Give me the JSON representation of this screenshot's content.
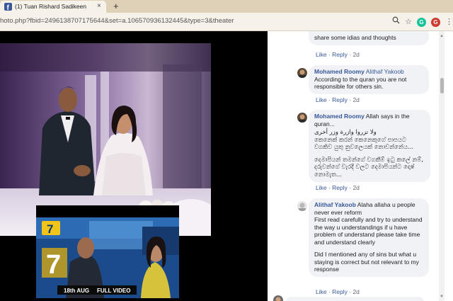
{
  "browser": {
    "tab_title": "(1) Tuan Rishard Sadikeen",
    "tab_close": "×",
    "new_tab": "+",
    "url": "hoto.php?fbid=2496138707175644&set=a.106570936132445&type=3&theater"
  },
  "video": {
    "badge_date": "18th AUG",
    "badge_text": "FULL VIDEO",
    "logo_text": "7"
  },
  "comments": [
    {
      "id": "c0",
      "text": "share some idias and thoughts",
      "like": "Like",
      "reply": "Reply",
      "time": "2d"
    },
    {
      "id": "c1",
      "author": "Mohamed Roomy",
      "tag": "Alithaf Yakoob",
      "text": "According to the quran you are not responsible for others sin.",
      "like": "Like",
      "reply": "Reply",
      "time": "2d"
    },
    {
      "id": "c2",
      "author": "Mohamed Roomy",
      "text_first": "Allah says in the quran...",
      "arabic": "ولا تزروا وازرة وزر أخرى",
      "sinhala_1": "කෙනෙක් කරන් කෙනෙකුගේ පාපයට වගකිව යුතු නුවලෙයක් නොවන්නේය...",
      "sinhala_2": "දෙමාපියන් තමන්ගේ වගකීම් ඉටු කලේ නම්, දරුවන්ගේ වැරදි වලට දෙමාපියන්ට දොෂ් නොමැත...",
      "like": "Like",
      "reply": "Reply",
      "time": "2d"
    },
    {
      "id": "c3",
      "author": "Alithaf Yakoob",
      "text_first": "Alaha allaha u people never ever reform",
      "para2": "First read carefully and try to understand the way u understandings if u have problem of understand please take time and understand clearly",
      "para3": "Did I mentioned any of sins but what u staying is correct but not relevant to my response",
      "like": "Like",
      "reply": "Reply",
      "time": "2d"
    }
  ],
  "icons": {
    "search": "search-icon",
    "star": "star-icon",
    "grammarly": "grammarly-icon",
    "g": "g-extension-icon",
    "menu": "menu-icon"
  },
  "colors": {
    "tabbar": "#ded1b7",
    "link_blue": "#385898",
    "bubble": "#f0f2f5"
  }
}
